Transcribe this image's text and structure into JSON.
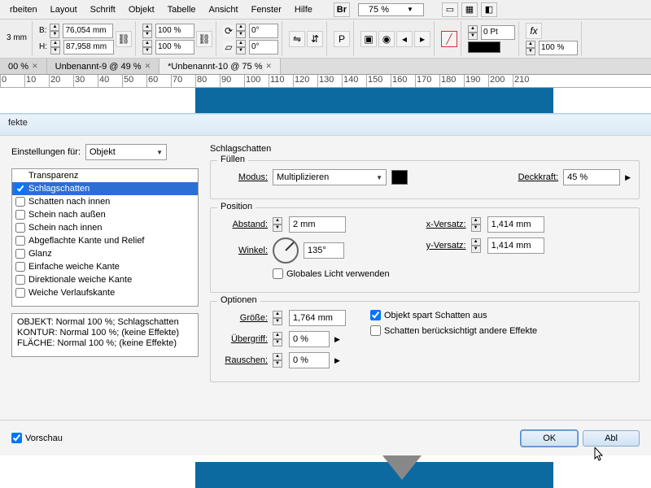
{
  "menu": {
    "items": [
      "rbeiten",
      "Layout",
      "Schrift",
      "Objekt",
      "Tabelle",
      "Ansicht",
      "Fenster",
      "Hilfe"
    ],
    "br_label": "Br",
    "zoom": "75 %"
  },
  "toolbar": {
    "b_label": "B:",
    "b_val": "76,054 mm",
    "h_label": "H:",
    "h_val": "87,958 mm",
    "scale1": "100 %",
    "scale2": "100 %",
    "rot": "0°",
    "shear": "0°",
    "stroke_label": "0 Pt",
    "opacity": "100 %",
    "mm_label": "3 mm"
  },
  "tabs": {
    "t1": "00 %",
    "t2": "Unbenannt-9 @ 49 %",
    "t3": "*Unbenannt-10 @ 75 %"
  },
  "ruler": [
    "0",
    "10",
    "20",
    "30",
    "40",
    "50",
    "60",
    "70",
    "80",
    "90",
    "100",
    "110",
    "120",
    "130",
    "140",
    "150",
    "160",
    "170",
    "180",
    "190",
    "200",
    "210"
  ],
  "dialog": {
    "title": "fekte",
    "settings_for_label": "Einstellungen für:",
    "settings_for_value": "Objekt",
    "effects": [
      "Transparenz",
      "Schlagschatten",
      "Schatten nach innen",
      "Schein nach außen",
      "Schein nach innen",
      "Abgeflachte Kante und Relief",
      "Glanz",
      "Einfache weiche Kante",
      "Direktionale weiche Kante",
      "Weiche Verlaufskante"
    ],
    "effects_checked": [
      false,
      true,
      false,
      false,
      false,
      false,
      false,
      false,
      false,
      false
    ],
    "selected_index": 1,
    "summary_l1": "OBJEKT: Normal 100 %; Schlagschatten",
    "summary_l2": "KONTUR: Normal 100 %; (keine Effekte)",
    "summary_l3": "FLÄCHE: Normal 100 %; (keine Effekte)",
    "panel_title": "Schlagschatten",
    "fill_legend": "Füllen",
    "mode_label": "Modus:",
    "mode_value": "Multiplizieren",
    "opacity_label": "Deckkraft:",
    "opacity_value": "45 %",
    "pos_legend": "Position",
    "abstand_label": "Abstand:",
    "abstand_value": "2 mm",
    "winkel_label": "Winkel:",
    "winkel_value": "135°",
    "global_light": "Globales Licht verwenden",
    "global_light_checked": false,
    "xoff_label": "x-Versatz:",
    "xoff_value": "1,414 mm",
    "yoff_label": "y-Versatz:",
    "yoff_value": "1,414 mm",
    "opt_legend": "Optionen",
    "size_label": "Größe:",
    "size_value": "1,764 mm",
    "spread_label": "Übergriff:",
    "spread_value": "0 %",
    "noise_label": "Rauschen:",
    "noise_value": "0 %",
    "knockout_label": "Objekt spart Schatten aus",
    "knockout_checked": true,
    "honors_label": "Schatten berücksichtigt andere Effekte",
    "honors_checked": false,
    "preview_label": "Vorschau",
    "preview_checked": true,
    "ok": "OK",
    "cancel": "Abl"
  }
}
